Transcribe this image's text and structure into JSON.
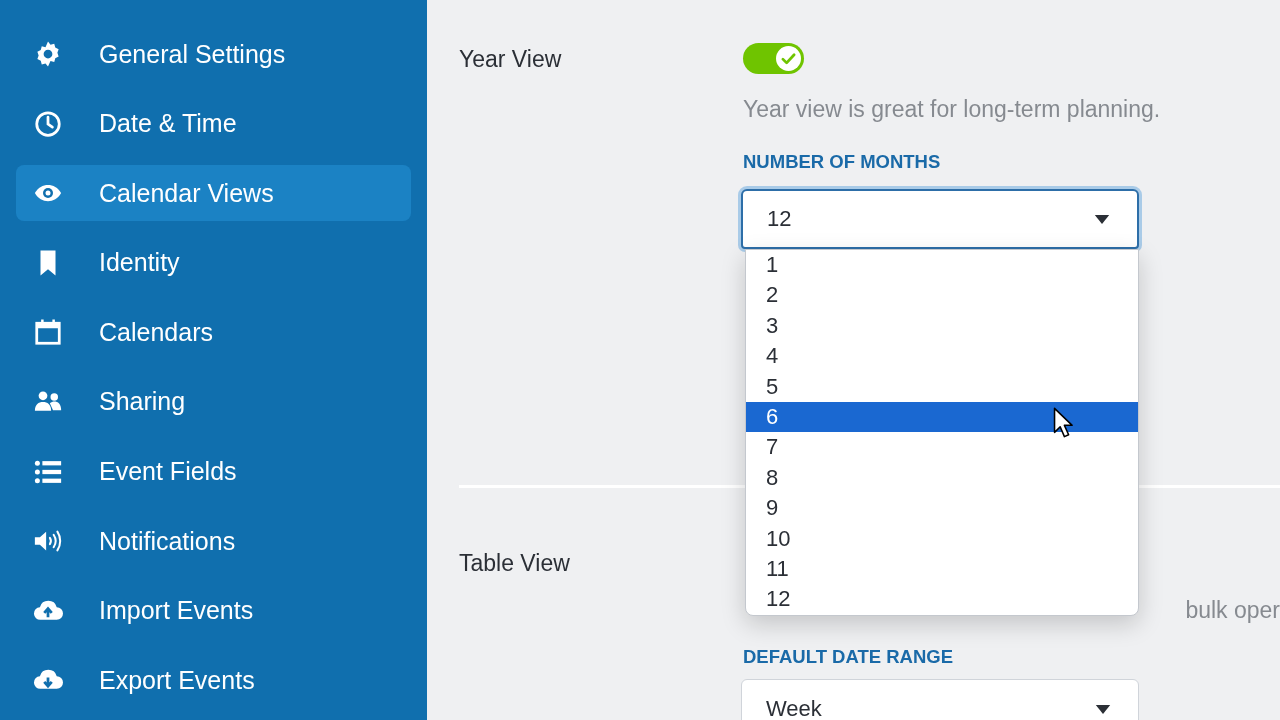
{
  "sidebar": {
    "items": [
      {
        "label": "General Settings",
        "selected": false
      },
      {
        "label": "Date & Time",
        "selected": false
      },
      {
        "label": "Calendar Views",
        "selected": true
      },
      {
        "label": "Identity",
        "selected": false
      },
      {
        "label": "Calendars",
        "selected": false
      },
      {
        "label": "Sharing",
        "selected": false
      },
      {
        "label": "Event Fields",
        "selected": false
      },
      {
        "label": "Notifications",
        "selected": false
      },
      {
        "label": "Import Events",
        "selected": false
      },
      {
        "label": "Export Events",
        "selected": false
      }
    ]
  },
  "sections": [
    {
      "title": "Year View",
      "toggle": {
        "on": true
      },
      "description": "Year view is great for long-term planning.",
      "field": {
        "label": "NUMBER OF MONTHS",
        "value": "12",
        "focused": true,
        "open": true
      }
    },
    {
      "title": "Table View",
      "description": "bulk oper",
      "field": {
        "label": "DEFAULT DATE RANGE",
        "value": "Week",
        "focused": false
      }
    }
  ],
  "dropdown": {
    "options": [
      {
        "label": "1",
        "selected": false
      },
      {
        "label": "2",
        "selected": false
      },
      {
        "label": "3",
        "selected": false
      },
      {
        "label": "4",
        "selected": false
      },
      {
        "label": "5",
        "selected": false
      },
      {
        "label": "6",
        "selected": true
      },
      {
        "label": "7",
        "selected": false
      },
      {
        "label": "8",
        "selected": false
      },
      {
        "label": "9",
        "selected": false
      },
      {
        "label": "10",
        "selected": false
      },
      {
        "label": "11",
        "selected": false
      },
      {
        "label": "12",
        "selected": false
      }
    ]
  }
}
